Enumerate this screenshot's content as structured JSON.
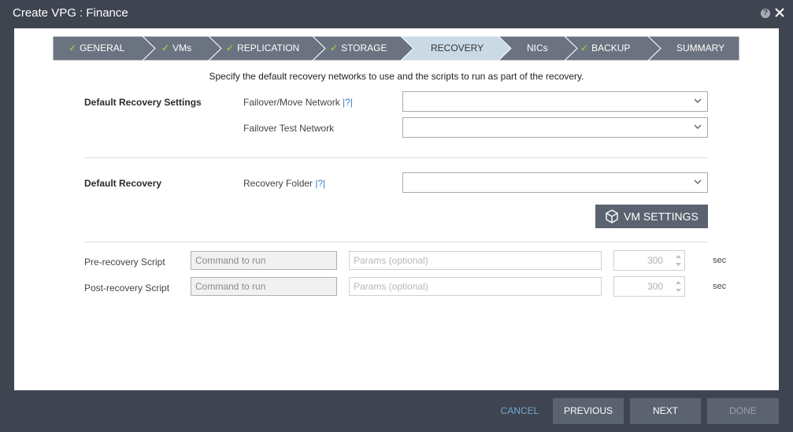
{
  "window": {
    "title": "Create VPG : Finance"
  },
  "wizard": {
    "steps": [
      {
        "label": "GENERAL",
        "done": true
      },
      {
        "label": "VMs",
        "done": true
      },
      {
        "label": "REPLICATION",
        "done": true
      },
      {
        "label": "STORAGE",
        "done": true
      },
      {
        "label": "RECOVERY",
        "done": false,
        "active": true
      },
      {
        "label": "NICs",
        "done": false
      },
      {
        "label": "BACKUP",
        "done": true
      },
      {
        "label": "SUMMARY",
        "done": false
      }
    ]
  },
  "intro": "Specify the default recovery networks to use and the scripts to run as part of the recovery.",
  "recovery_settings": {
    "heading": "Default Recovery Settings",
    "failover_label": "Failover/Move Network",
    "help_mark": "|?|",
    "failover_value": "",
    "test_label": "Failover Test Network",
    "test_value": ""
  },
  "default_recovery": {
    "heading": "Default Recovery",
    "folder_label": "Recovery Folder",
    "help_mark": "|?|",
    "folder_value": ""
  },
  "vm_settings_label": "VM SETTINGS",
  "scripts": {
    "pre": {
      "label": "Pre-recovery Script",
      "command_placeholder": "Command to run",
      "params_placeholder": "Params (optional)",
      "timeout": "300",
      "unit": "sec"
    },
    "post": {
      "label": "Post-recovery Script",
      "command_placeholder": "Command to run",
      "params_placeholder": "Params (optional)",
      "timeout": "300",
      "unit": "sec"
    }
  },
  "footer": {
    "cancel": "CANCEL",
    "previous": "PREVIOUS",
    "next": "NEXT",
    "done": "DONE"
  },
  "colors": {
    "frame": "#3e4450",
    "step_bg": "#6b7280",
    "step_active": "#c9d9e6",
    "check": "#8dc63f",
    "button": "#5b6270",
    "link": "#6fa8d6"
  }
}
